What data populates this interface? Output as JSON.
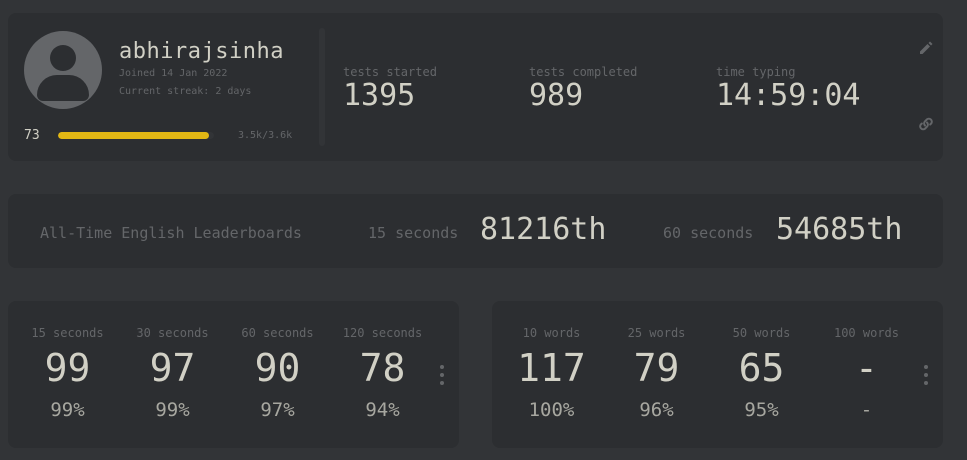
{
  "profile": {
    "username": "abhirajsinha",
    "joined": "Joined 14 Jan 2022",
    "streak": "Current streak: 2 days",
    "level": "73",
    "xp_text": "3.5k/3.6k",
    "xp_progress": 0.97,
    "stats": [
      {
        "label": "tests started",
        "value": "1395"
      },
      {
        "label": "tests completed",
        "value": "989"
      },
      {
        "label": "time typing",
        "value": "14:59:04"
      }
    ],
    "edit_icon": "pencil-icon",
    "link_icon": "link-icon"
  },
  "leaderboard": {
    "title": "All-Time English Leaderboards",
    "entries": [
      {
        "label": "15 seconds",
        "rank": "81216th"
      },
      {
        "label": "60 seconds",
        "rank": "54685th"
      }
    ]
  },
  "pb_time": [
    {
      "label": "15 seconds",
      "wpm": "99",
      "acc": "99%"
    },
    {
      "label": "30 seconds",
      "wpm": "97",
      "acc": "99%"
    },
    {
      "label": "60 seconds",
      "wpm": "90",
      "acc": "97%"
    },
    {
      "label": "120 seconds",
      "wpm": "78",
      "acc": "94%"
    }
  ],
  "pb_words": [
    {
      "label": "10 words",
      "wpm": "117",
      "acc": "100%"
    },
    {
      "label": "25 words",
      "wpm": "79",
      "acc": "96%"
    },
    {
      "label": "50 words",
      "wpm": "65",
      "acc": "95%"
    },
    {
      "label": "100 words",
      "wpm": "-",
      "acc": "-"
    }
  ],
  "colors": {
    "background": "#323437",
    "card": "#2c2e31",
    "text": "#d1d0c5",
    "subtext": "#646669",
    "accent": "#e2b714"
  }
}
